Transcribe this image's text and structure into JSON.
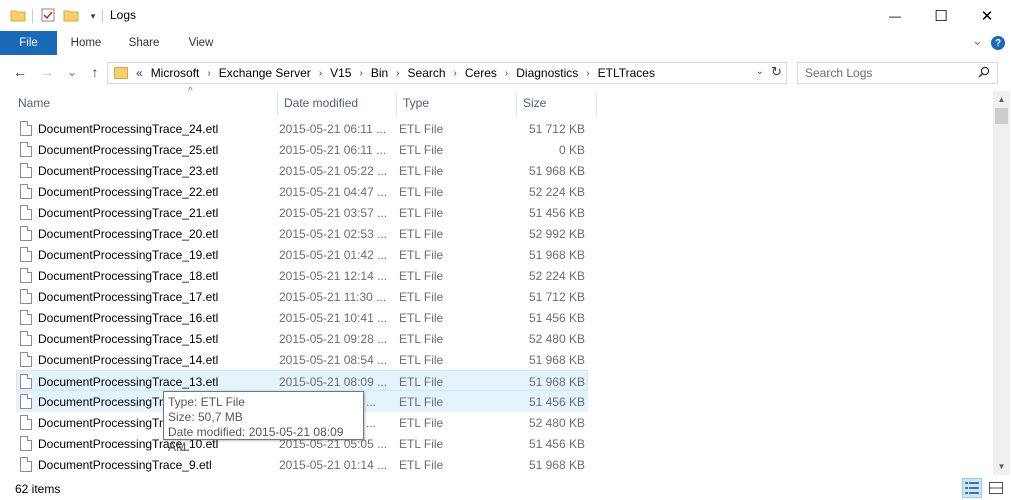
{
  "window": {
    "title": "Logs",
    "minimize": "—",
    "maximize": "☐",
    "close": "✕"
  },
  "ribbon": {
    "tabs": [
      "File",
      "Home",
      "Share",
      "View"
    ],
    "expand": "⌄",
    "help": "?"
  },
  "navigation": {
    "back": "←",
    "forward": "→",
    "recent": "⌄",
    "up": "↑",
    "overflow": "«",
    "breadcrumbs": [
      "Microsoft",
      "Exchange Server",
      "V15",
      "Bin",
      "Search",
      "Ceres",
      "Diagnostics",
      "ETLTraces"
    ],
    "separator": "›",
    "dropdown": "⌄",
    "refresh": "↻",
    "search_placeholder": "Search Logs"
  },
  "columns": {
    "name": "Name",
    "date": "Date modified",
    "type": "Type",
    "size": "Size",
    "sort_indicator": "^"
  },
  "files": [
    {
      "name": "DocumentProcessingTrace_24.etl",
      "date": "2015-05-21 06:11 ...",
      "type": "ETL File",
      "size": "51 712 KB"
    },
    {
      "name": "DocumentProcessingTrace_25.etl",
      "date": "2015-05-21 06:11 ...",
      "type": "ETL File",
      "size": "0 KB"
    },
    {
      "name": "DocumentProcessingTrace_23.etl",
      "date": "2015-05-21 05:22 ...",
      "type": "ETL File",
      "size": "51 968 KB"
    },
    {
      "name": "DocumentProcessingTrace_22.etl",
      "date": "2015-05-21 04:47 ...",
      "type": "ETL File",
      "size": "52 224 KB"
    },
    {
      "name": "DocumentProcessingTrace_21.etl",
      "date": "2015-05-21 03:57 ...",
      "type": "ETL File",
      "size": "51 456 KB"
    },
    {
      "name": "DocumentProcessingTrace_20.etl",
      "date": "2015-05-21 02:53 ...",
      "type": "ETL File",
      "size": "52 992 KB"
    },
    {
      "name": "DocumentProcessingTrace_19.etl",
      "date": "2015-05-21 01:42 ...",
      "type": "ETL File",
      "size": "51 968 KB"
    },
    {
      "name": "DocumentProcessingTrace_18.etl",
      "date": "2015-05-21 12:14 ...",
      "type": "ETL File",
      "size": "52 224 KB"
    },
    {
      "name": "DocumentProcessingTrace_17.etl",
      "date": "2015-05-21 11:30 ...",
      "type": "ETL File",
      "size": "51 712 KB"
    },
    {
      "name": "DocumentProcessingTrace_16.etl",
      "date": "2015-05-21 10:41 ...",
      "type": "ETL File",
      "size": "51 456 KB"
    },
    {
      "name": "DocumentProcessingTrace_15.etl",
      "date": "2015-05-21 09:28 ...",
      "type": "ETL File",
      "size": "52 480 KB"
    },
    {
      "name": "DocumentProcessingTrace_14.etl",
      "date": "2015-05-21 08:54 ...",
      "type": "ETL File",
      "size": "51 968 KB"
    },
    {
      "name": "DocumentProcessingTrace_13.etl",
      "date": "2015-05-21 08:09 ...",
      "type": "ETL File",
      "size": "51 968 KB"
    },
    {
      "name": "DocumentProcessingTr",
      "date": "...",
      "type": "ETL File",
      "size": "51 456 KB"
    },
    {
      "name": "DocumentProcessingTr",
      "date": "...",
      "type": "ETL File",
      "size": "52 480 KB"
    },
    {
      "name": "DocumentProcessingTrace_10.etl",
      "date": "2015-05-21 05:05 ...",
      "type": "ETL File",
      "size": "51 456 KB"
    },
    {
      "name": "DocumentProcessingTrace_9.etl",
      "date": "2015-05-21 01:14 ...",
      "type": "ETL File",
      "size": "51 968 KB"
    }
  ],
  "tooltip": {
    "type_line": "Type: ETL File",
    "size_line": "Size: 50,7 MB",
    "date_line": "Date modified: 2015-05-21 08:09 AM"
  },
  "scrollbar": {
    "up": "▲",
    "down": "▼"
  },
  "status": {
    "item_count": "62 items"
  },
  "colors": {
    "file_tab": "#1a68b8",
    "header_text": "#4c607a",
    "hover_bg": "#e5f3ff",
    "folder": "#f5cf6a"
  }
}
